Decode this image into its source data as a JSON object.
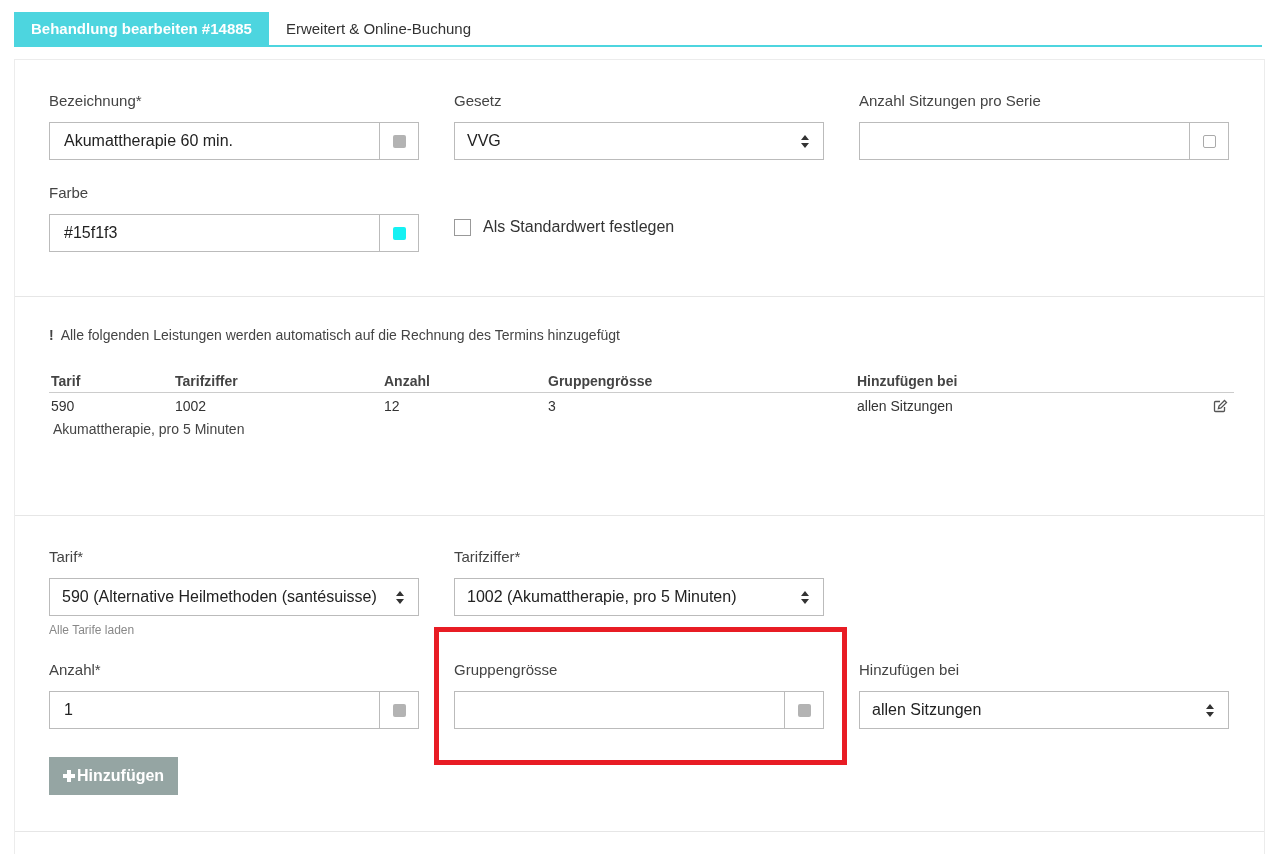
{
  "tabs": [
    {
      "label": "Behandlung bearbeiten #14885",
      "selected": true
    },
    {
      "label": "Erweitert & Online-Buchung",
      "selected": false
    }
  ],
  "general": {
    "rows": [
      [
        {
          "kind": "text",
          "label": "Bezeichnung*",
          "value": "Akumattherapie 60 min.",
          "addon": {
            "kind": "square"
          }
        },
        {
          "kind": "select",
          "label": "Gesetz",
          "value": "VVG"
        },
        {
          "kind": "text",
          "label": "Anzahl Sitzungen pro Serie",
          "addon": {
            "kind": "checkbox"
          }
        }
      ],
      [
        {
          "kind": "text",
          "label": "Farbe",
          "value": "#15f1f3",
          "addon": {
            "kind": "swatch",
            "color": "#15f1f3"
          }
        },
        {
          "kind": "checkbox",
          "label": "Als Standardwert festlegen",
          "checked": false
        }
      ]
    ]
  },
  "services": {
    "notice": {
      "mark": "!",
      "text": "Alle folgenden Leistungen werden automatisch auf die Rechnung des Termins hinzugefügt"
    },
    "columns": [
      "Tarif",
      "Tarifziffer",
      "Anzahl",
      "Gruppengrösse",
      "Hinzufügen bei"
    ],
    "rows": [
      {
        "cells": [
          "590",
          "1002",
          "12",
          "3",
          "allen Sitzungen"
        ],
        "description": "Akumattherapie, pro 5 Minuten"
      }
    ]
  },
  "new_service": {
    "rows": [
      [
        {
          "kind": "select",
          "label": "Tarif*",
          "value": "590 (Alternative Heilmethoden (santésuisse)",
          "hint": "Alle Tarife laden"
        },
        {
          "kind": "select",
          "label": "Tarifziffer*",
          "value": "1002 (Akumattherapie, pro 5 Minuten)"
        }
      ],
      [
        {
          "kind": "text",
          "label": "Anzahl*",
          "value": "1",
          "addon": {
            "kind": "square"
          }
        },
        {
          "kind": "text",
          "label": "Gruppengrösse",
          "addon": {
            "kind": "square"
          },
          "highlighted": true
        },
        {
          "kind": "select",
          "label": "Hinzufügen bei",
          "value": "allen Sitzungen"
        }
      ]
    ],
    "button": {
      "label": "Hinzufügen"
    }
  }
}
